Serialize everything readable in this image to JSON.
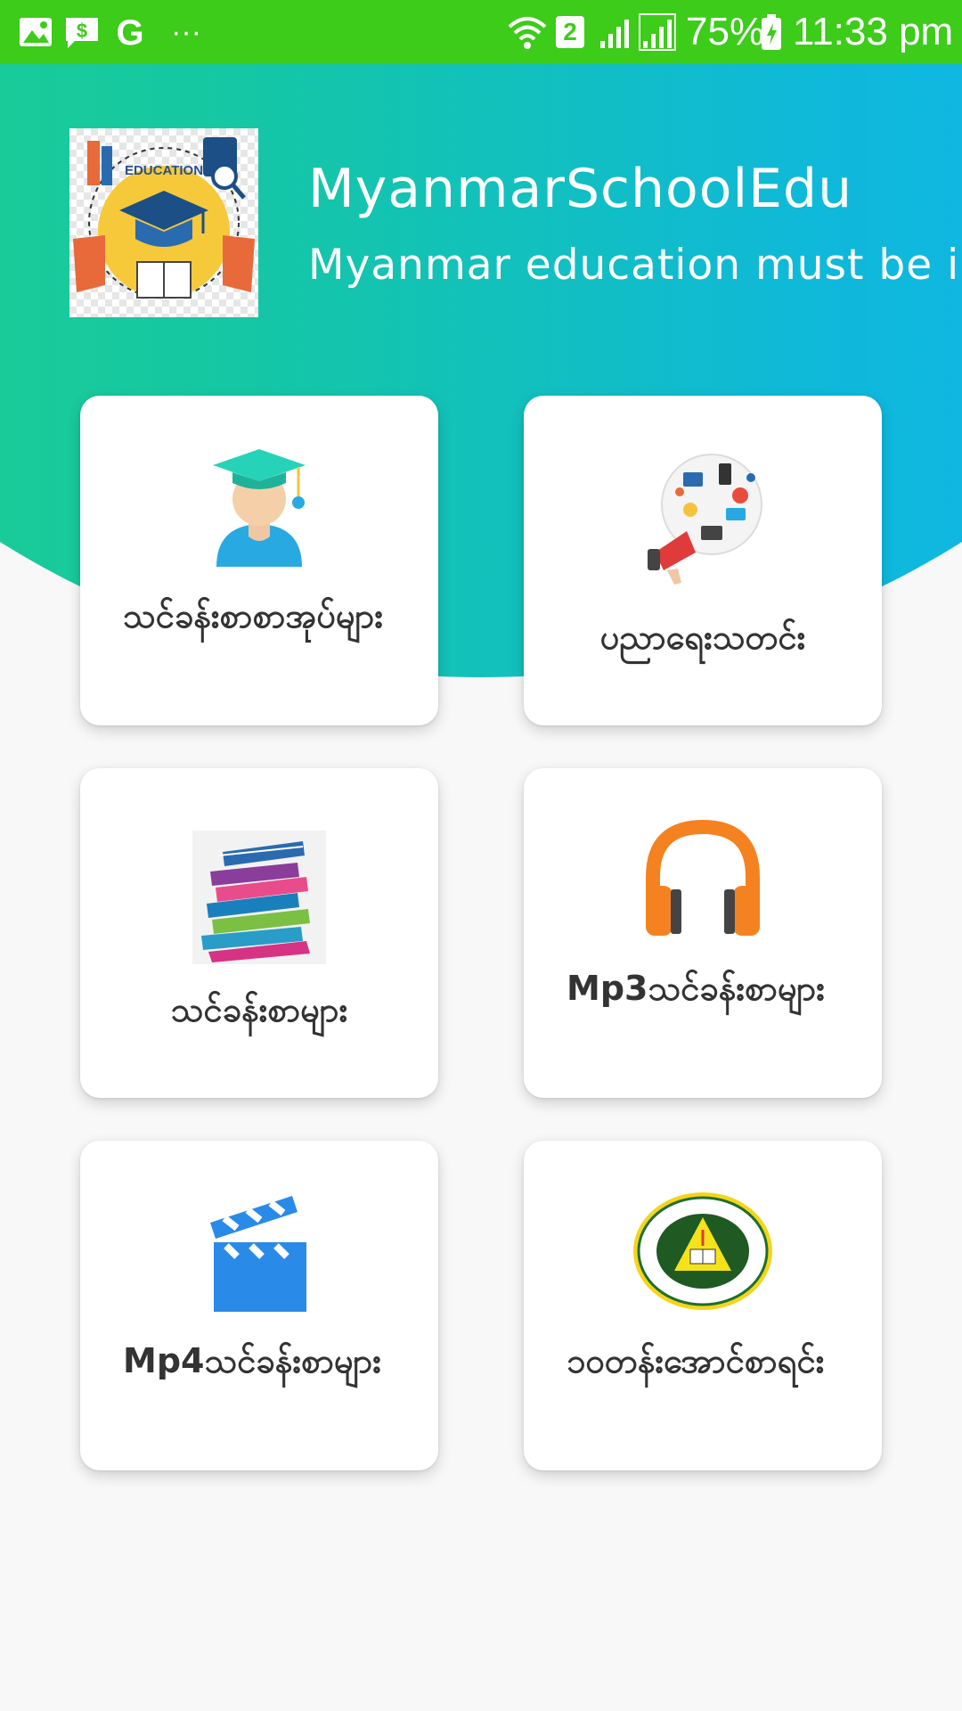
{
  "status_bar": {
    "battery_percent": "75%",
    "time": "11:33 pm",
    "sim_badge": "2",
    "overflow": "···",
    "icons": [
      "image-notification-icon",
      "message-money-icon",
      "google-icon",
      "wifi-icon",
      "sim-badge-icon",
      "signal-icon",
      "signal-icon",
      "battery-charging-icon"
    ]
  },
  "header": {
    "logo_text": "EDUCATION",
    "title": "MyanmarSchoolEdu",
    "subtitle": "Myanmar education must be improved"
  },
  "menu": [
    {
      "label": "သင်ခန်းစာစာအုပ်များ",
      "icon": "graduate-icon"
    },
    {
      "label": "ပညာရေးသတင်း",
      "icon": "education-news-megaphone-icon"
    },
    {
      "label": "သင်ခန်းစာများ",
      "icon": "books-stack-icon"
    },
    {
      "label": "Mp3သင်ခန်းစာများ",
      "icon": "headphones-icon"
    },
    {
      "label": "Mp4သင်ခန်းစာများ",
      "icon": "clapperboard-icon"
    },
    {
      "label": "၁၀တန်းအောင်စာရင်း",
      "icon": "exam-board-seal-icon"
    }
  ],
  "colors": {
    "status_bar": "#3ccc19",
    "gradient_start": "#1fd08a",
    "gradient_end": "#10b3f0",
    "card_text": "#333333"
  }
}
